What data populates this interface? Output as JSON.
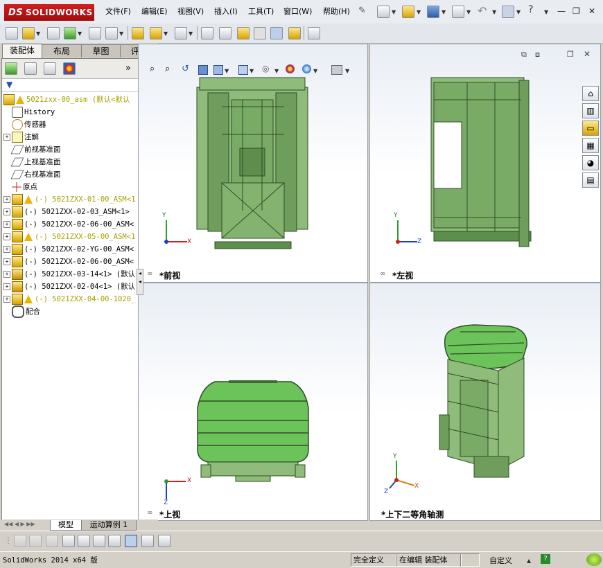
{
  "app": {
    "name": "SOLIDWORKS",
    "logo_prefix": "DS"
  },
  "menu": {
    "items": [
      "文件(F)",
      "编辑(E)",
      "视图(V)",
      "插入(I)",
      "工具(T)",
      "窗口(W)",
      "帮助(H)"
    ]
  },
  "tabs": {
    "items": [
      "装配体",
      "布局",
      "草图",
      "评估"
    ],
    "active": "装配体"
  },
  "tree": {
    "root": "5021zxx-00_asm (默认<默认",
    "items": [
      {
        "label": "History",
        "expand": "",
        "icon": "history-icon"
      },
      {
        "label": "传感器",
        "expand": "",
        "icon": "sensor-icon"
      },
      {
        "label": "注解",
        "expand": "+",
        "icon": "annotation-icon"
      },
      {
        "label": "前视基准面",
        "expand": "",
        "icon": "plane-icon"
      },
      {
        "label": "上视基准面",
        "expand": "",
        "icon": "plane-icon"
      },
      {
        "label": "右视基准面",
        "expand": "",
        "icon": "plane-icon"
      },
      {
        "label": "原点",
        "expand": "",
        "icon": "origin-icon"
      },
      {
        "label": "(-) 5021ZXX-01-00_ASM<1",
        "expand": "+",
        "icon": "assembly-icon",
        "warn": true
      },
      {
        "label": "(-) 5021ZXX-02-03_ASM<1>",
        "expand": "+",
        "icon": "assembly-icon"
      },
      {
        "label": "(-) 5021ZXX-02-06-00_ASM<",
        "expand": "+",
        "icon": "assembly-icon"
      },
      {
        "label": "(-) 5021ZXX-05-00_ASM<1",
        "expand": "+",
        "icon": "assembly-icon",
        "warn": true
      },
      {
        "label": "(-) 5021ZXX-02-YG-00_ASM<",
        "expand": "+",
        "icon": "assembly-icon"
      },
      {
        "label": "(-) 5021ZXX-02-06-00_ASM<",
        "expand": "+",
        "icon": "assembly-icon"
      },
      {
        "label": "(-) 5021ZXX-03-14<1> (默认",
        "expand": "+",
        "icon": "part-icon"
      },
      {
        "label": "(-) 5021ZXX-02-04<1> (默认",
        "expand": "+",
        "icon": "part-icon"
      },
      {
        "label": "(-) 5021ZXX-04-00-1020_",
        "expand": "+",
        "icon": "assembly-icon",
        "warn": true
      },
      {
        "label": "配合",
        "expand": "",
        "icon": "mates-icon"
      }
    ]
  },
  "viewports": [
    {
      "label": "*前视",
      "axis_h": "X",
      "axis_v": "Y"
    },
    {
      "label": "*左视",
      "axis_h": "Z",
      "axis_v": "Y"
    },
    {
      "label": "*上视",
      "axis_h": "X",
      "axis_v": "Z"
    },
    {
      "label": "*上下二等角轴测",
      "axis_h": "X",
      "axis_v": "Y",
      "axis_d": "Z"
    }
  ],
  "bottom_tabs": {
    "items": [
      "模型",
      "运动算例 1"
    ]
  },
  "status": {
    "app_version": "SolidWorks 2014 x64 版",
    "definition": "完全定义",
    "editing": "在编辑 装配体",
    "custom": "自定义",
    "help": "?"
  },
  "colors": {
    "model_green": "#7fb36a",
    "model_dark": "#3f6a34",
    "logo_red": "#c01818"
  }
}
